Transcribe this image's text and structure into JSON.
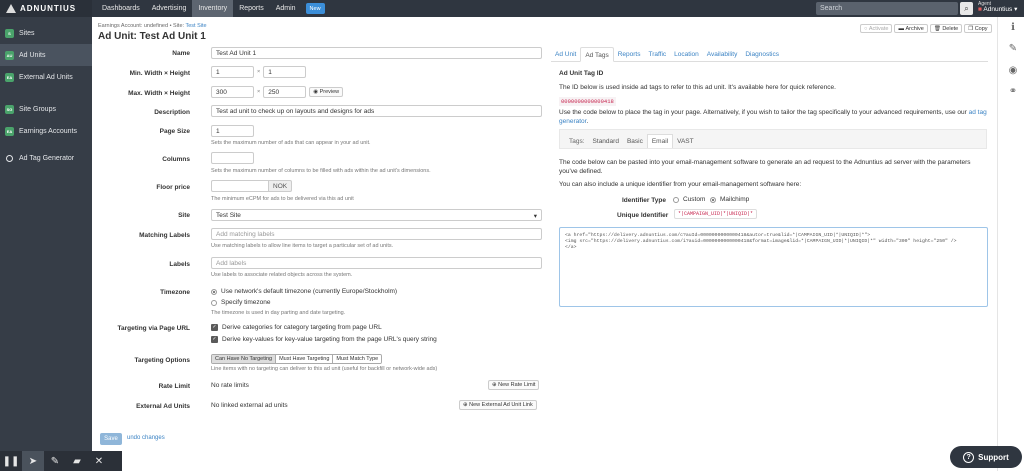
{
  "topbar": {
    "logo": "ADNUNTIUS",
    "nav": [
      "Dashboards",
      "Advertising",
      "Inventory",
      "Reports",
      "Admin"
    ],
    "new_label": "New",
    "search_placeholder": "Search",
    "user_small": "Agent",
    "user_name": "Adnuntius"
  },
  "sidebar": {
    "items": [
      {
        "badge": "S",
        "label": "Sites"
      },
      {
        "badge": "AU",
        "label": "Ad Units"
      },
      {
        "badge": "EA",
        "label": "External Ad Units"
      },
      {
        "badge": "SG",
        "label": "Site Groups"
      },
      {
        "badge": "EA",
        "label": "Earnings Accounts"
      },
      {
        "badge": "",
        "label": "Ad Tag Generator"
      }
    ]
  },
  "breadcrumb": {
    "prefix": "Earnings Account:",
    "account": "undefined",
    "sep": "•",
    "site_prefix": "Site:",
    "site": "Test Site"
  },
  "page_title": "Ad Unit: Test Ad Unit 1",
  "actions": {
    "activate": "Activate",
    "archive": "Archive",
    "delete": "Delete",
    "copy": "Copy"
  },
  "form": {
    "name_label": "Name",
    "name_value": "Test Ad Unit 1",
    "min_label": "Min. Width × Height",
    "min_w": "1",
    "min_h": "1",
    "times": "×",
    "max_label": "Max. Width × Height",
    "max_w": "300",
    "max_h": "250",
    "preview": "Preview",
    "desc_label": "Description",
    "desc_value": "Test ad unit to check up on layouts and designs for ads",
    "page_size_label": "Page Size",
    "page_size_value": "1",
    "page_size_help": "Sets the maximum number of ads that can appear in your ad unit.",
    "columns_label": "Columns",
    "columns_help": "Sets the maximum number of columns to be filled with ads within the ad unit's dimensions.",
    "floor_label": "Floor price",
    "floor_currency": "NOK",
    "floor_help": "The minimum eCPM for ads to be delivered via this ad unit",
    "site_label": "Site",
    "site_value": "Test Site",
    "matching_label": "Matching Labels",
    "matching_placeholder": "Add matching labels",
    "matching_help": "Use matching labels to allow line items to target a particular set of ad units.",
    "labels_label": "Labels",
    "labels_placeholder": "Add labels",
    "labels_help": "Use labels to associate related objects across the system.",
    "timezone_label": "Timezone",
    "tz_opt1": "Use network's default timezone (currently Europe/Stockholm)",
    "tz_opt2": "Specify timezone",
    "tz_help": "The timezone is used in day parting and date targeting.",
    "targeting_url_label": "Targeting via Page URL",
    "url_opt1": "Derive categories for category targeting from page URL",
    "url_opt2": "Derive key-values for key-value targeting from the page URL's query string",
    "targeting_options_label": "Targeting Options",
    "to_opts": [
      "Can Have No Targeting",
      "Must Have Targeting",
      "Must Match Type"
    ],
    "to_help": "Line items with no targeting can deliver to this ad unit (useful for backfill or network-wide ads)",
    "rate_label": "Rate Limit",
    "rate_value": "No rate limits",
    "rate_btn": "New Rate Limit",
    "ext_label": "External Ad Units",
    "ext_value": "No linked external ad units",
    "ext_btn": "New External Ad Unit Link",
    "save": "Save",
    "undo": "undo changes"
  },
  "right": {
    "tabs": [
      "Ad Unit",
      "Ad Tags",
      "Reports",
      "Traffic",
      "Location",
      "Availability",
      "Diagnostics"
    ],
    "heading": "Ad Unit Tag ID",
    "intro": "The ID below is used inside ad tags to refer to this ad unit. It's available here for quick reference.",
    "tag_id": "0000000000000418",
    "place_text": "Use the code below to place the tag in your page. Alternatively, if you wish to tailor the tag specifically to your advanced requirements, use our",
    "place_link": "ad tag generator",
    "subtabs_label": "Tags:",
    "subtabs": [
      "Standard",
      "Basic",
      "Email",
      "VAST"
    ],
    "email_text": "The code below can be pasted into your email-management software to generate an ad request to the Adnuntius ad server with the parameters you've defined.",
    "unique_text": "You can also include a unique identifier from your email-management software here:",
    "id_type_label": "Identifier Type",
    "id_custom": "Custom",
    "id_mailchimp": "Mailchimp",
    "unique_label": "Unique Identifier",
    "unique_value": "*|CAMPAIGN_UID|*|UNIQID|*",
    "code_line1": "<a href=\"https://delivery.adnuntius.com/c?auId=0000000000000418&autor=true&lid=*|CAMPAIGN_UID|*|UNIQID|*\">",
    "code_line2": "  <img src=\"https://delivery.adnuntius.com/i?auid=0000000000000418&format=image&lid=*|CAMPAIGN_UID|*|UNIQID|*\" width=\"300\" height=\"250\" />",
    "code_line3": "</a>"
  },
  "support": "Support"
}
